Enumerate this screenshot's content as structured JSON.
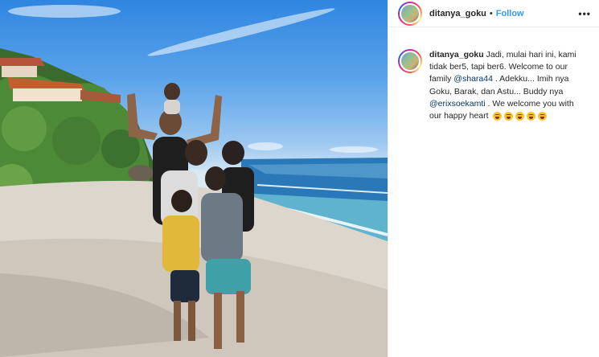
{
  "post": {
    "username": "ditanya_goku",
    "separator": "•",
    "follow_label": "Follow",
    "more_label": "•••"
  },
  "caption": {
    "username": "ditanya_goku",
    "text_1": " Jadi, mulai hari ini, kami tidak ber5, tapi ber6. Welcome to our family ",
    "mention_1": "@shara44",
    "text_2": " . Adekku... Imih nya Goku, Barak, dan Astu... Buddy nya ",
    "mention_2": "@erixsoekamti",
    "text_3": " . We welcome you with our happy heart ",
    "emoji_icons": [
      "smiling-face-icon",
      "smiling-face-icon",
      "smiling-face-icon",
      "smiling-face-icon",
      "smiling-face-icon"
    ]
  },
  "colors": {
    "link": "#3897f0",
    "mention": "#003569",
    "text": "#262626"
  }
}
